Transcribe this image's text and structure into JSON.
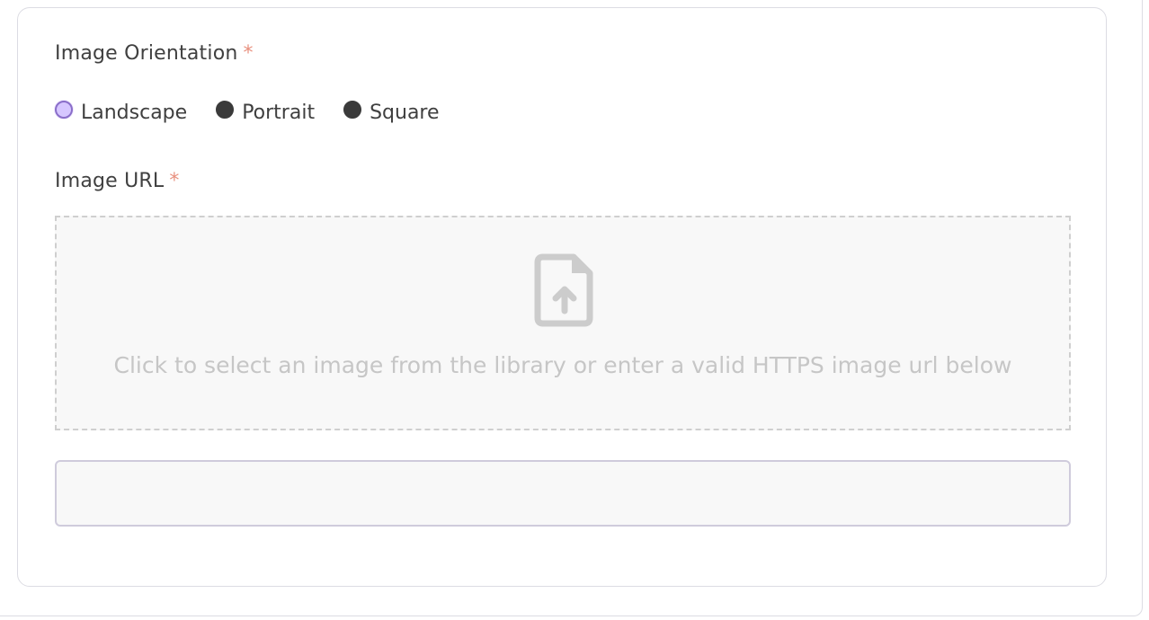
{
  "orientation": {
    "label": "Image Orientation",
    "required_mark": "*",
    "options": [
      {
        "label": "Landscape",
        "checked": true
      },
      {
        "label": "Portrait",
        "checked": false
      },
      {
        "label": "Square",
        "checked": false
      }
    ]
  },
  "image_url": {
    "label": "Image URL",
    "required_mark": "*",
    "dropzone_icon": "file-upload-icon",
    "dropzone_text": "Click to select an image from the library or enter a valid HTTPS image url below",
    "input_value": "",
    "input_placeholder": ""
  },
  "colors": {
    "required": "#e8907e",
    "radio_checked_fill": "#d6c6ff",
    "radio_checked_border": "#8a6ec9",
    "radio_unchecked": "#3a3a3a"
  }
}
